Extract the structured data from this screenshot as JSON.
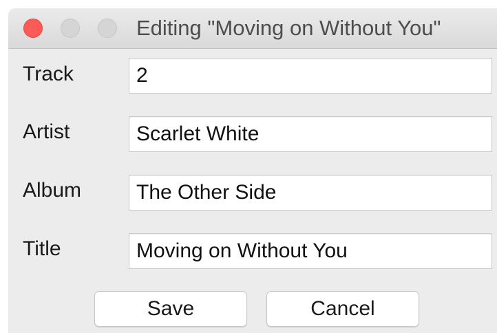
{
  "window": {
    "title": "Editing \"Moving on Without You\""
  },
  "form": {
    "track": {
      "label": "Track",
      "value": "2"
    },
    "artist": {
      "label": "Artist",
      "value": "Scarlet White"
    },
    "album": {
      "label": "Album",
      "value": "The Other Side"
    },
    "title": {
      "label": "Title",
      "value": "Moving on Without You"
    }
  },
  "buttons": {
    "save_label": "Save",
    "cancel_label": "Cancel"
  },
  "colors": {
    "close_button": "#fc5b57",
    "inactive_button": "#d5d5d5",
    "window_background": "#ececec"
  }
}
